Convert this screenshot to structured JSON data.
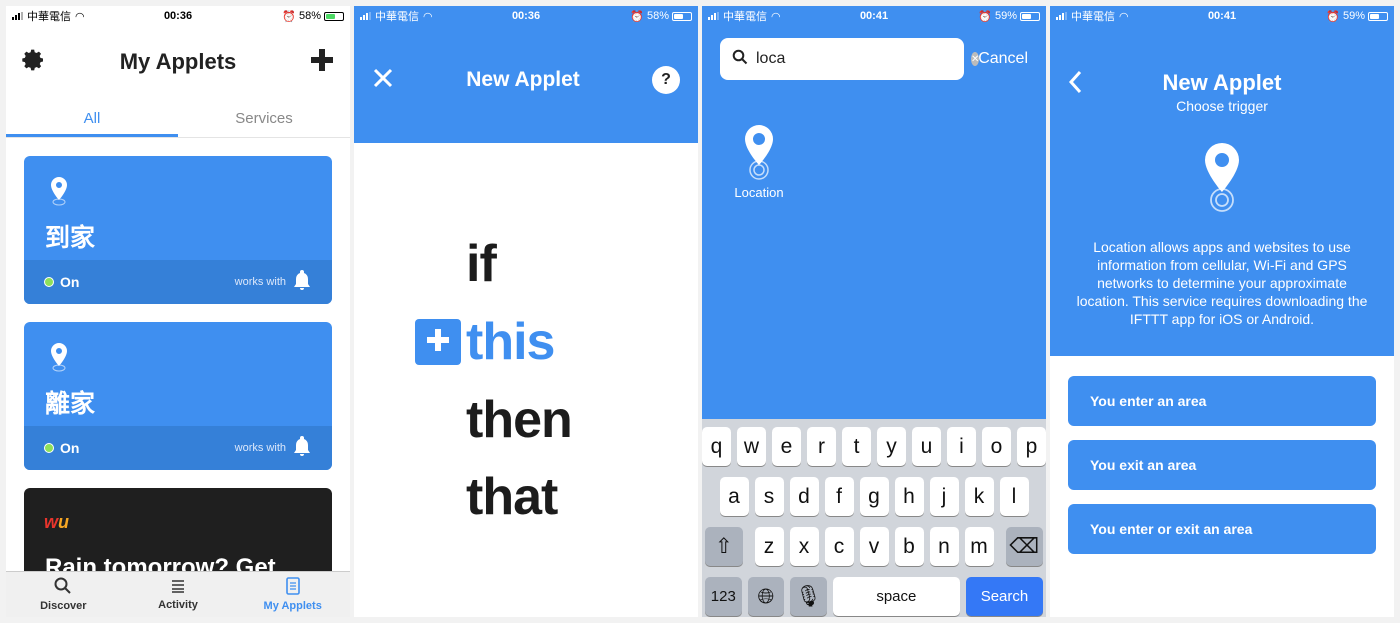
{
  "status": {
    "carrier": "中華電信",
    "s1": {
      "time": "00:36",
      "battery": "58%",
      "level": 0.58
    },
    "s2": {
      "time": "00:36",
      "battery": "58%",
      "level": 0.58
    },
    "s3": {
      "time": "00:41",
      "battery": "59%",
      "level": 0.59
    },
    "s4": {
      "time": "00:41",
      "battery": "59%",
      "level": 0.59
    }
  },
  "applets": {
    "title": "My Applets",
    "tabs": [
      "All",
      "Services"
    ],
    "cards": [
      {
        "title": "到家",
        "status": "On",
        "works_with": "works with"
      },
      {
        "title": "離家",
        "status": "On",
        "works_with": "works with"
      }
    ],
    "promo": {
      "brand": "wu",
      "title": "Rain tomorrow? Get"
    },
    "tabbar": [
      "Discover",
      "Activity",
      "My Applets"
    ]
  },
  "new_applet": {
    "title": "New Applet",
    "help": "?",
    "words": {
      "if": "if",
      "this": "this",
      "then": "then",
      "that": "that"
    }
  },
  "search": {
    "query": "loca",
    "cancel": "Cancel",
    "result": "Location",
    "keyboard": {
      "row1": [
        "q",
        "w",
        "e",
        "r",
        "t",
        "y",
        "u",
        "i",
        "o",
        "p"
      ],
      "row2": [
        "a",
        "s",
        "d",
        "f",
        "g",
        "h",
        "j",
        "k",
        "l"
      ],
      "row3": [
        "z",
        "x",
        "c",
        "v",
        "b",
        "n",
        "m"
      ],
      "num": "123",
      "space": "space",
      "action": "Search"
    }
  },
  "trigger": {
    "title": "New Applet",
    "subtitle": "Choose trigger",
    "description": "Location allows apps and websites to use information from cellular, Wi-Fi and GPS networks to determine your approximate location. This service requires downloading the IFTTT app for iOS or Android.",
    "options": [
      "You enter an area",
      "You exit an area",
      "You enter or exit an area"
    ]
  },
  "colors": {
    "accent": "#3f8ff0",
    "on_dot": "#8ee05a"
  }
}
